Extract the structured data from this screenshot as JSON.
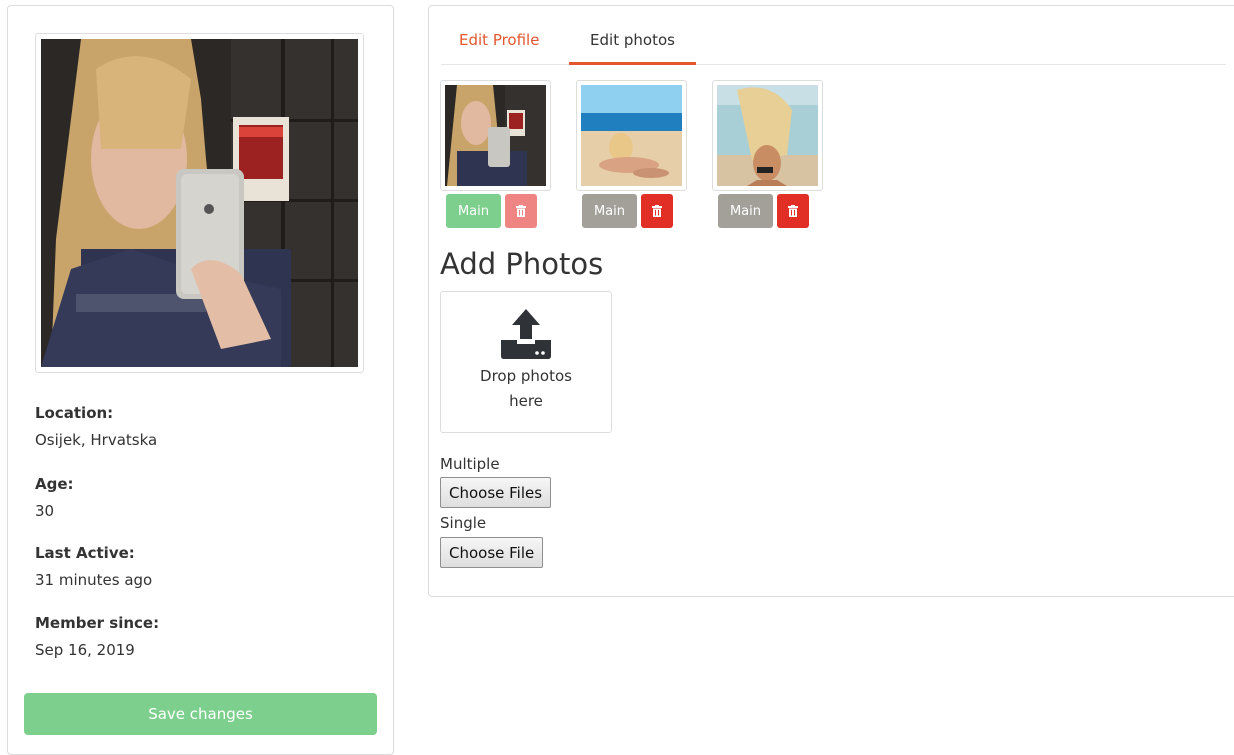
{
  "profile": {
    "location_label": "Location:",
    "location_value": "Osijek, Hrvatska",
    "age_label": "Age:",
    "age_value": "30",
    "last_active_label": "Last Active:",
    "last_active_value": "31 minutes ago",
    "member_since_label": "Member since:",
    "member_since_value": "Sep 16, 2019",
    "save_label": "Save changes"
  },
  "tabs": [
    {
      "label": "Edit Profile",
      "active": false
    },
    {
      "label": "Edit photos",
      "active": true
    }
  ],
  "photos": [
    {
      "main_label": "Main",
      "is_main": true,
      "delete_icon": "trash-icon"
    },
    {
      "main_label": "Main",
      "is_main": false,
      "delete_icon": "trash-icon"
    },
    {
      "main_label": "Main",
      "is_main": false,
      "delete_icon": "trash-icon"
    }
  ],
  "upload": {
    "title": "Add Photos",
    "drop_text": "Drop photos here",
    "drop_icon": "upload-icon",
    "multiple_label": "Multiple",
    "multiple_button": "Choose Files",
    "single_label": "Single",
    "single_button": "Choose File"
  },
  "colors": {
    "accent": "#e4572e",
    "success": "#7ccf8c",
    "danger": "#e12f25",
    "muted": "#a3a09a"
  }
}
